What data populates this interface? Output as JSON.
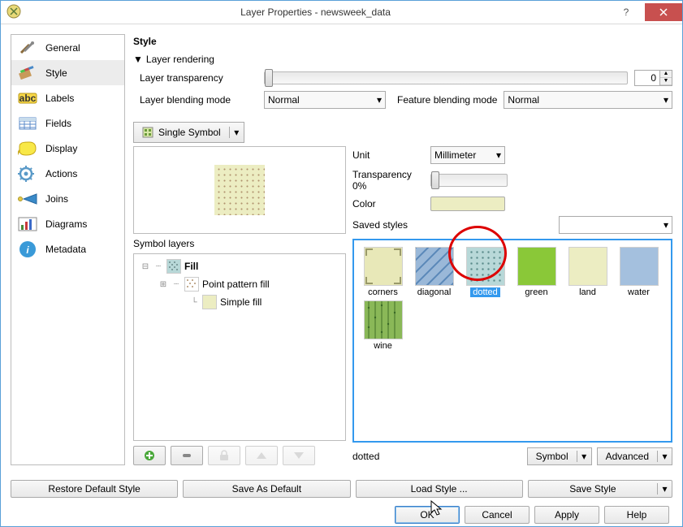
{
  "window": {
    "title": "Layer Properties - newsweek_data"
  },
  "sidebar": {
    "items": [
      {
        "label": "General"
      },
      {
        "label": "Style",
        "selected": true
      },
      {
        "label": "Labels"
      },
      {
        "label": "Fields"
      },
      {
        "label": "Display"
      },
      {
        "label": "Actions"
      },
      {
        "label": "Joins"
      },
      {
        "label": "Diagrams"
      },
      {
        "label": "Metadata"
      }
    ]
  },
  "style": {
    "section_title": "Style",
    "rendering_label": "Layer rendering",
    "transparency_label": "Layer transparency",
    "transparency_value": "0",
    "blending_label": "Layer blending mode",
    "blending_value": "Normal",
    "feature_blending_label": "Feature blending mode",
    "feature_blending_value": "Normal",
    "symbol_type": "Single Symbol",
    "symbol_layers_label": "Symbol layers",
    "tree": {
      "fill": "Fill",
      "point_pattern": "Point pattern fill",
      "simple_fill": "Simple fill"
    },
    "unit_label": "Unit",
    "unit_value": "Millimeter",
    "trans2_label": "Transparency 0%",
    "color_label": "Color",
    "saved_styles_label": "Saved styles",
    "styles": [
      {
        "name": "corners"
      },
      {
        "name": "diagonal"
      },
      {
        "name": "dotted",
        "selected": true
      },
      {
        "name": "green"
      },
      {
        "name": "land"
      },
      {
        "name": "water"
      },
      {
        "name": "wine"
      }
    ],
    "selected_style": "dotted",
    "symbol_button": "Symbol",
    "advanced_button": "Advanced"
  },
  "bottom": {
    "restore": "Restore Default Style",
    "save_default": "Save As Default",
    "load": "Load Style ...",
    "save": "Save Style"
  },
  "dialog": {
    "ok": "OK",
    "cancel": "Cancel",
    "apply": "Apply",
    "help": "Help"
  }
}
